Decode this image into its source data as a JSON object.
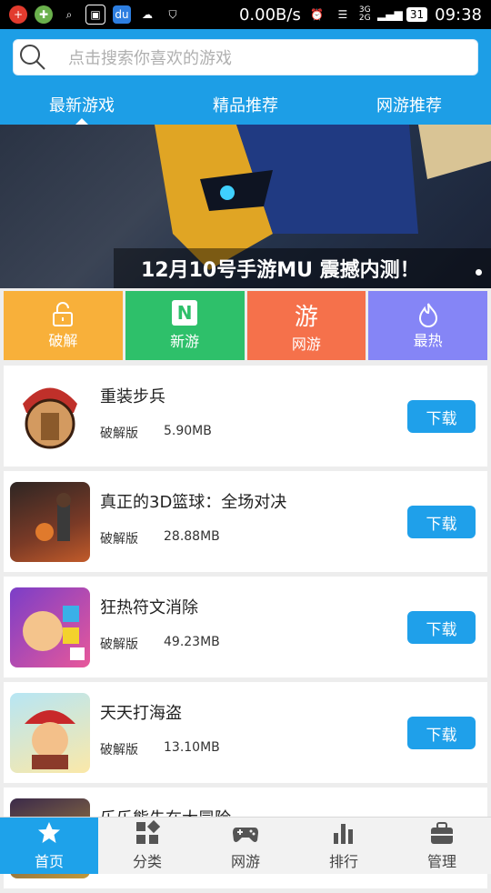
{
  "status": {
    "net_speed": "0.00B/s",
    "battery": "31",
    "time": "09:38",
    "net_type": "3G 2G"
  },
  "search": {
    "placeholder": "点击搜索你喜欢的游戏"
  },
  "tabs": [
    {
      "label": "最新游戏"
    },
    {
      "label": "精品推荐"
    },
    {
      "label": "网游推荐"
    }
  ],
  "banner": {
    "caption": "12月10号手游MU 震撼内测！"
  },
  "categories": [
    {
      "label": "破解",
      "color": "#f8b03a",
      "icon": "lock-icon"
    },
    {
      "label": "新游",
      "color": "#2ec06a",
      "icon": "new-icon",
      "glyph": "N"
    },
    {
      "label": "网游",
      "color": "#f5714b",
      "icon": "online-game-icon",
      "glyph": "游"
    },
    {
      "label": "最热",
      "color": "#8585f6",
      "icon": "flame-icon"
    }
  ],
  "apps": [
    {
      "name": "重装步兵",
      "tag": "破解版",
      "size": "5.90MB",
      "button": "下载"
    },
    {
      "name": "真正的3D篮球：全场对决",
      "tag": "破解版",
      "size": "28.88MB",
      "button": "下载"
    },
    {
      "name": "狂热符文消除",
      "tag": "破解版",
      "size": "49.23MB",
      "button": "下载"
    },
    {
      "name": "天天打海盗",
      "tag": "破解版",
      "size": "13.10MB",
      "button": "下载"
    },
    {
      "name": "乐乐熊先在大冒险",
      "tag": "",
      "size": "",
      "button": ""
    }
  ],
  "nav": [
    {
      "label": "首页",
      "icon": "star-icon"
    },
    {
      "label": "分类",
      "icon": "grid-icon"
    },
    {
      "label": "网游",
      "icon": "gamepad-icon"
    },
    {
      "label": "排行",
      "icon": "bars-icon"
    },
    {
      "label": "管理",
      "icon": "briefcase-icon"
    }
  ]
}
